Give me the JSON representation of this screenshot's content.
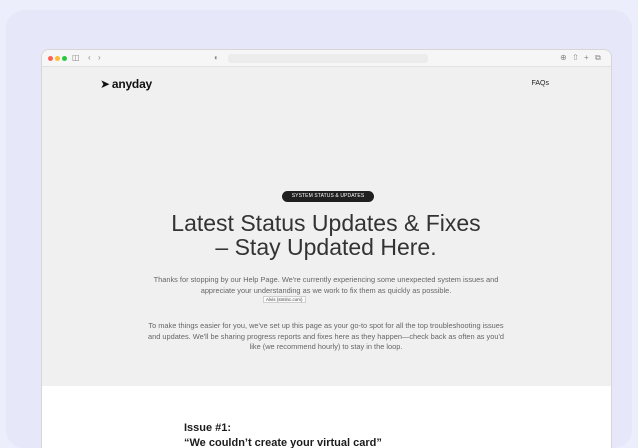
{
  "brand": {
    "logo_text": "anyday"
  },
  "nav": {
    "faqs_label": "FAQs"
  },
  "hero": {
    "badge": "SYSTEM STATUS & UPDATES",
    "title_line1": "Latest Status Updates & Fixes",
    "title_line2": "– Stay Updated Here.",
    "paragraph1": "Thanks for stopping by our Help Page. We're currently experiencing some unexpected system issues and appreciate your understanding as we work to fix them as quickly as possible.",
    "paragraph2": "To make things easier for you, we've set up this page as your go-to spot for all the top troubleshooting issues and updates. We'll be sharing progress reports and fixes here as they happen—check back as often as you'd like (we recommend hourly) to stay in the loop.",
    "tooltip": "Alvis (stmlnc.com)"
  },
  "issue": {
    "number_label": "Issue #1:",
    "title": "“We couldn’t create your virtual card”"
  },
  "colors": {
    "background": "#eceefb",
    "badge_bg": "#1f1f1f",
    "page_bg": "#f0f0f0"
  }
}
